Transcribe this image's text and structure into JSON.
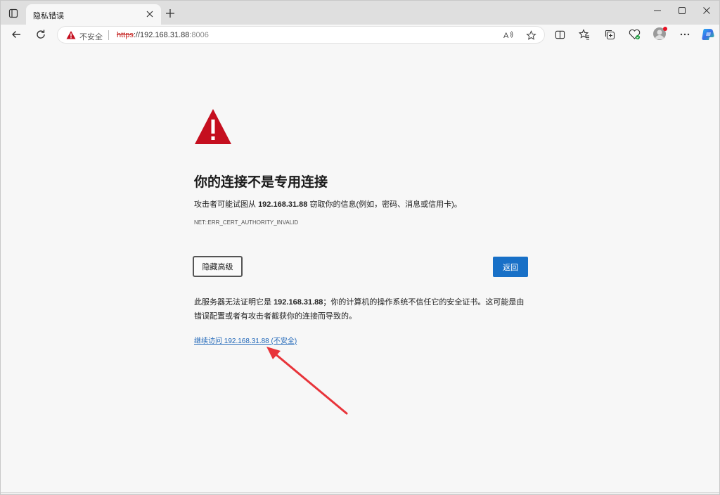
{
  "tab": {
    "title": "隐私错误"
  },
  "address": {
    "not_secure_label": "不安全",
    "url_scheme": "https",
    "url_host": "://192.168.31.88",
    "url_port": ":8006"
  },
  "page": {
    "heading": "你的连接不是专用连接",
    "desc_before": "攻击者可能试图从 ",
    "desc_host": "192.168.31.88",
    "desc_after": " 窃取你的信息(例如，密码、消息或信用卡)。",
    "error_code": "NET::ERR_CERT_AUTHORITY_INVALID",
    "hide_advanced_label": "隐藏高级",
    "back_label": "返回",
    "detail_before": "此服务器无法证明它是 ",
    "detail_host": "192.168.31.88",
    "detail_after": "；你的计算机的操作系统不信任它的安全证书。这可能是由错误配置或者有攻击者截获你的连接而导致的。",
    "proceed_link": "继续访问 192.168.31.88 (不安全)"
  },
  "colors": {
    "danger": "#c50f1f",
    "primary_button": "#1870c7",
    "link": "#1f66b8",
    "annotation_arrow": "#e8343a"
  },
  "icons": {
    "tab_actions": "tab-actions-icon",
    "back": "back-arrow-icon",
    "refresh": "refresh-icon",
    "warning": "warning-triangle-icon",
    "favorite": "star-icon"
  }
}
